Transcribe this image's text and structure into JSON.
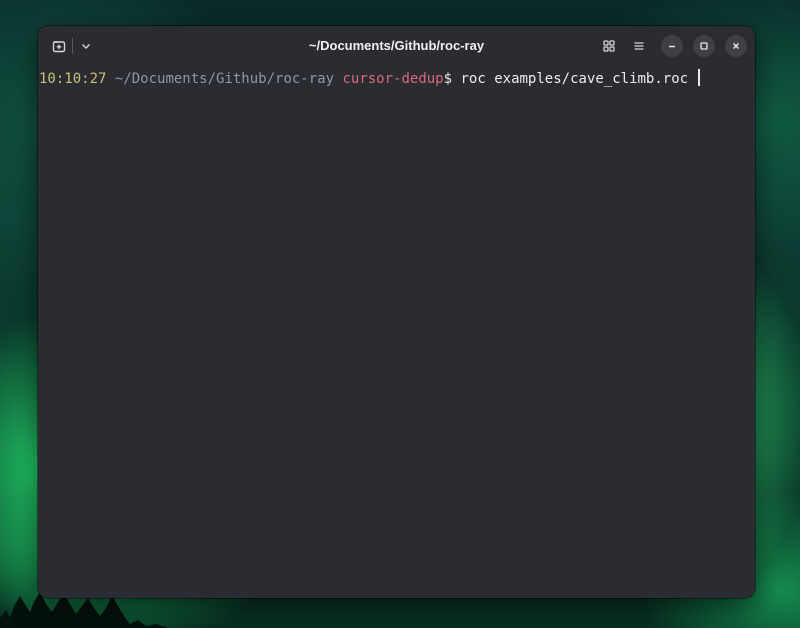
{
  "window": {
    "title": "~/Documents/Github/roc-ray",
    "icons": {
      "new_tab": "new-tab-icon",
      "dropdown": "chevron-down-icon",
      "grid": "tab-overview-icon",
      "menu": "hamburger-menu-icon",
      "minimize": "minimize-icon",
      "maximize": "maximize-icon",
      "close": "close-icon"
    }
  },
  "terminal": {
    "time": "10:10:27",
    "path": "~/Documents/Github/roc-ray",
    "branch": "cursor-dedup",
    "prompt_symbol": "$",
    "command": "roc examples/cave_climb.roc"
  },
  "colors": {
    "time": "#c9c078",
    "path": "#8c97a8",
    "branch": "#d76a7a",
    "background": "#2b2c31"
  }
}
